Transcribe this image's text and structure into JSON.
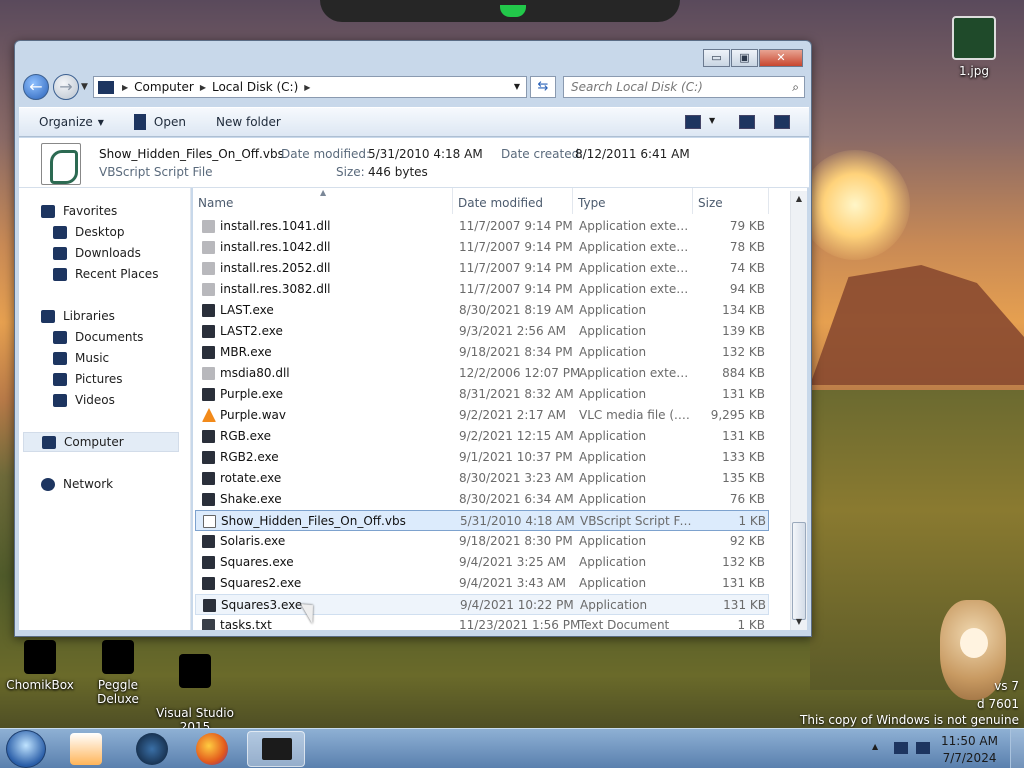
{
  "desktop": {
    "icons": [
      {
        "label": "1.jpg"
      },
      {
        "label": "ChomikBox"
      },
      {
        "label": "Peggle Deluxe"
      },
      {
        "label": "Visual Studio\n2015"
      }
    ],
    "watermark": {
      "line1": "vs 7",
      "line2": "d 7601",
      "line3": "This copy of Windows is not genuine"
    }
  },
  "window": {
    "minimize_label": "▭",
    "maximize_label": "▣",
    "close_label": "✕"
  },
  "address": {
    "crumbs": [
      "Computer",
      "Local Disk (C:)"
    ],
    "search_placeholder": "Search Local Disk (C:)"
  },
  "toolbar": {
    "organize": "Organize",
    "open": "Open",
    "new_folder": "New folder"
  },
  "details": {
    "filename": "Show_Hidden_Files_On_Off.vbs",
    "filetype": "VBScript Script File",
    "modified_label": "Date modified:",
    "modified_value": "5/31/2010 4:18 AM",
    "created_label": "Date created:",
    "created_value": "8/12/2011 6:41 AM",
    "size_label": "Size:",
    "size_value": "446 bytes"
  },
  "nav": {
    "favorites": "Favorites",
    "desktop": "Desktop",
    "downloads": "Downloads",
    "recent": "Recent Places",
    "libraries": "Libraries",
    "documents": "Documents",
    "music": "Music",
    "pictures": "Pictures",
    "videos": "Videos",
    "computer": "Computer",
    "network": "Network"
  },
  "columns": {
    "name": "Name",
    "date": "Date modified",
    "type": "Type",
    "size": "Size"
  },
  "files": [
    {
      "name": "install.res.1041.dll",
      "date": "11/7/2007 9:14 PM",
      "type": "Application extens...",
      "size": "79 KB",
      "kind": "dll"
    },
    {
      "name": "install.res.1042.dll",
      "date": "11/7/2007 9:14 PM",
      "type": "Application extens...",
      "size": "78 KB",
      "kind": "dll"
    },
    {
      "name": "install.res.2052.dll",
      "date": "11/7/2007 9:14 PM",
      "type": "Application extens...",
      "size": "74 KB",
      "kind": "dll"
    },
    {
      "name": "install.res.3082.dll",
      "date": "11/7/2007 9:14 PM",
      "type": "Application extens...",
      "size": "94 KB",
      "kind": "dll"
    },
    {
      "name": "LAST.exe",
      "date": "8/30/2021 8:19 AM",
      "type": "Application",
      "size": "134 KB",
      "kind": "exe"
    },
    {
      "name": "LAST2.exe",
      "date": "9/3/2021 2:56 AM",
      "type": "Application",
      "size": "139 KB",
      "kind": "exe"
    },
    {
      "name": "MBR.exe",
      "date": "9/18/2021 8:34 PM",
      "type": "Application",
      "size": "132 KB",
      "kind": "exe"
    },
    {
      "name": "msdia80.dll",
      "date": "12/2/2006 12:07 PM",
      "type": "Application extens...",
      "size": "884 KB",
      "kind": "dll"
    },
    {
      "name": "Purple.exe",
      "date": "8/31/2021 8:32 AM",
      "type": "Application",
      "size": "131 KB",
      "kind": "exe"
    },
    {
      "name": "Purple.wav",
      "date": "9/2/2021 2:17 AM",
      "type": "VLC media file (.w...",
      "size": "9,295 KB",
      "kind": "wav"
    },
    {
      "name": "RGB.exe",
      "date": "9/2/2021 12:15 AM",
      "type": "Application",
      "size": "131 KB",
      "kind": "exe"
    },
    {
      "name": "RGB2.exe",
      "date": "9/1/2021 10:37 PM",
      "type": "Application",
      "size": "133 KB",
      "kind": "exe"
    },
    {
      "name": "rotate.exe",
      "date": "8/30/2021 3:23 AM",
      "type": "Application",
      "size": "135 KB",
      "kind": "exe"
    },
    {
      "name": "Shake.exe",
      "date": "8/30/2021 6:34 AM",
      "type": "Application",
      "size": "76 KB",
      "kind": "exe"
    },
    {
      "name": "Show_Hidden_Files_On_Off.vbs",
      "date": "5/31/2010 4:18 AM",
      "type": "VBScript Script File",
      "size": "1 KB",
      "kind": "vbs",
      "state": "sel"
    },
    {
      "name": "Solaris.exe",
      "date": "9/18/2021 8:30 PM",
      "type": "Application",
      "size": "92 KB",
      "kind": "exe"
    },
    {
      "name": "Squares.exe",
      "date": "9/4/2021 3:25 AM",
      "type": "Application",
      "size": "132 KB",
      "kind": "exe"
    },
    {
      "name": "Squares2.exe",
      "date": "9/4/2021 3:43 AM",
      "type": "Application",
      "size": "131 KB",
      "kind": "exe"
    },
    {
      "name": "Squares3.exe",
      "date": "9/4/2021 10:22 PM",
      "type": "Application",
      "size": "131 KB",
      "kind": "exe",
      "state": "hov"
    },
    {
      "name": "tasks.txt",
      "date": "11/23/2021 1:56 PM",
      "type": "Text Document",
      "size": "1 KB",
      "kind": "txt"
    }
  ],
  "taskbar": {
    "time": "11:50 AM",
    "date": "7/7/2024"
  },
  "colors": {
    "accent": "#2a62b8",
    "selection": "#dcebfc"
  }
}
